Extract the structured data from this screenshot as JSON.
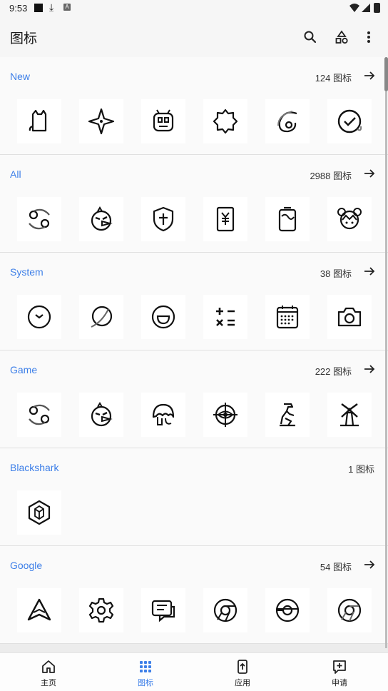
{
  "status_bar": {
    "time": "9:53",
    "download_glyph": "⤓",
    "badge": "A"
  },
  "app_bar": {
    "title": "图标",
    "actions": [
      "search-icon",
      "shapes-icon",
      "more-vert-icon"
    ]
  },
  "colors": {
    "accent": "#3d7fe8",
    "tile": "#ffffff",
    "section_bg": "#fafafa"
  },
  "sections": [
    {
      "title": "New",
      "count": "124 图标",
      "has_arrow": true,
      "icons": [
        "cat-icon",
        "sparkle-star-icon",
        "robot-face-icon",
        "gear-cog-icon",
        "swirl-icon",
        "check-circle-icon"
      ]
    },
    {
      "title": "All",
      "count": "2988 图标",
      "has_arrow": true,
      "icons": [
        "cancer-zodiac-icon",
        "angry-bird-icon",
        "shield-cross-icon",
        "yen-note-icon",
        "battery-wave-icon",
        "girl-face-icon"
      ]
    },
    {
      "title": "System",
      "count": "38 图标",
      "has_arrow": true,
      "icons": [
        "clock-icon",
        "planet-icon",
        "smile-face-icon",
        "calculator-icon",
        "calendar-icon",
        "camera-icon"
      ]
    },
    {
      "title": "Game",
      "count": "222 图标",
      "has_arrow": true,
      "icons": [
        "cancer-zodiac-icon",
        "angry-bird-icon",
        "mushroom-head-icon",
        "compass-eye-icon",
        "dinosaur-icon",
        "windmill-icon"
      ]
    },
    {
      "title": "Blackshark",
      "count": "1 图标",
      "has_arrow": false,
      "icons": [
        "hexagon-cube-icon"
      ]
    },
    {
      "title": "Google",
      "count": "54 图标",
      "has_arrow": true,
      "icons": [
        "android-auto-icon",
        "settings-gear-icon",
        "messages-icon",
        "chrome-icon",
        "chrome-beta-icon",
        "chrome-dev-icon"
      ]
    }
  ],
  "bottom_nav": [
    {
      "label": "主页",
      "icon": "home-icon",
      "active": false
    },
    {
      "label": "图标",
      "icon": "grid-dots-icon",
      "active": true
    },
    {
      "label": "应用",
      "icon": "apply-upload-icon",
      "active": false
    },
    {
      "label": "申请",
      "icon": "request-add-icon",
      "active": false
    }
  ]
}
